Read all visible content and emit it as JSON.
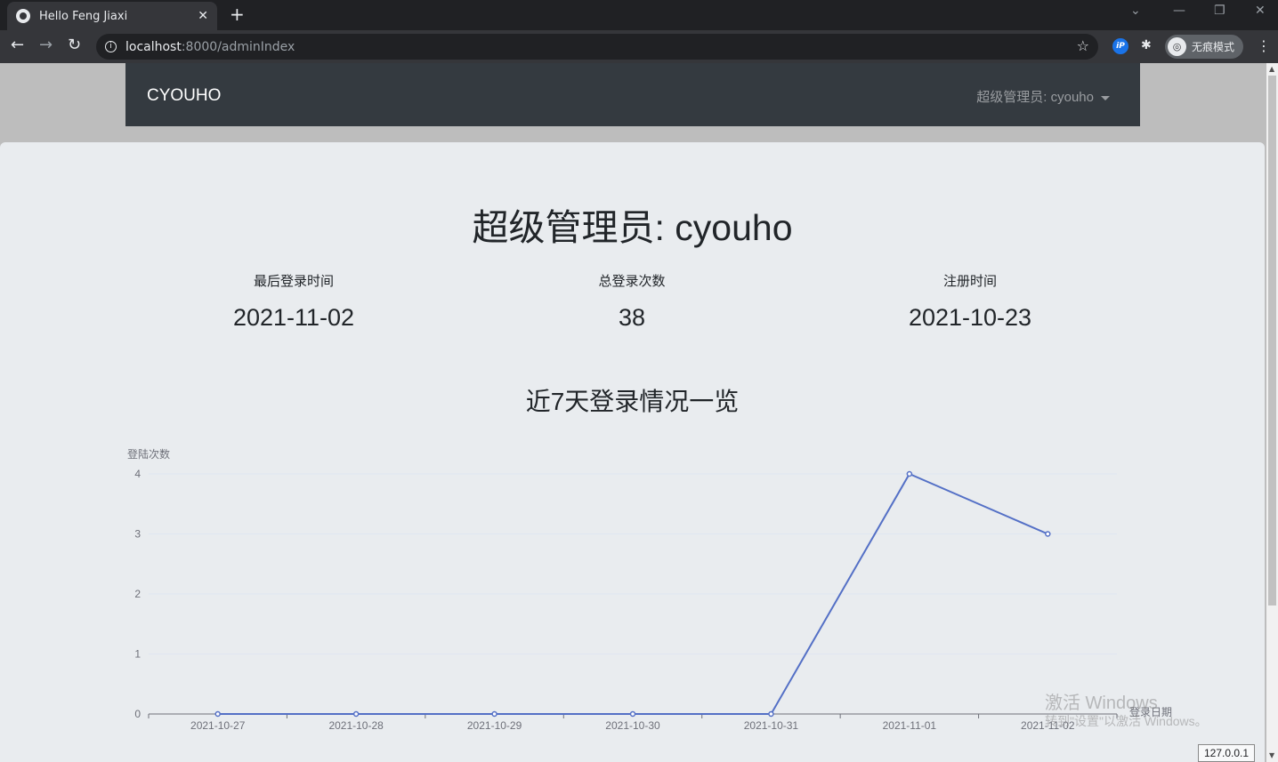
{
  "browser": {
    "tab_title": "Hello Feng Jiaxi",
    "tab_close": "✕",
    "new_tab": "+",
    "url_host": "localhost",
    "url_path": ":8000/adminIndex",
    "incognito_label": "无痕模式",
    "ext_label": "iP",
    "status_host": "127.0.0.1"
  },
  "navbar": {
    "brand": "CYOUHO",
    "user_menu": "超级管理员: cyouho"
  },
  "main": {
    "headline": "超级管理员: cyouho",
    "stats": [
      {
        "label": "最后登录时间",
        "value": "2021-11-02"
      },
      {
        "label": "总登录次数",
        "value": "38"
      },
      {
        "label": "注册时间",
        "value": "2021-10-23"
      }
    ],
    "chart_title": "近7天登录情况一览"
  },
  "watermark": {
    "line1": "激活 Windows",
    "line2": "转到\"设置\"以激活 Windows。"
  },
  "colors": {
    "series": "#5470c6",
    "navbar_bg": "#343a40",
    "card_bg": "#e9ecef"
  },
  "chart_data": {
    "type": "line",
    "title": "近7天登录情况一览",
    "xlabel": "登录日期",
    "ylabel": "登陆次数",
    "categories": [
      "2021-10-27",
      "2021-10-28",
      "2021-10-29",
      "2021-10-30",
      "2021-10-31",
      "2021-11-01",
      "2021-11-02"
    ],
    "values": [
      0,
      0,
      0,
      0,
      0,
      4,
      3
    ],
    "ylim": [
      0,
      4
    ],
    "yticks": [
      0,
      1,
      2,
      3,
      4
    ],
    "grid": true
  }
}
